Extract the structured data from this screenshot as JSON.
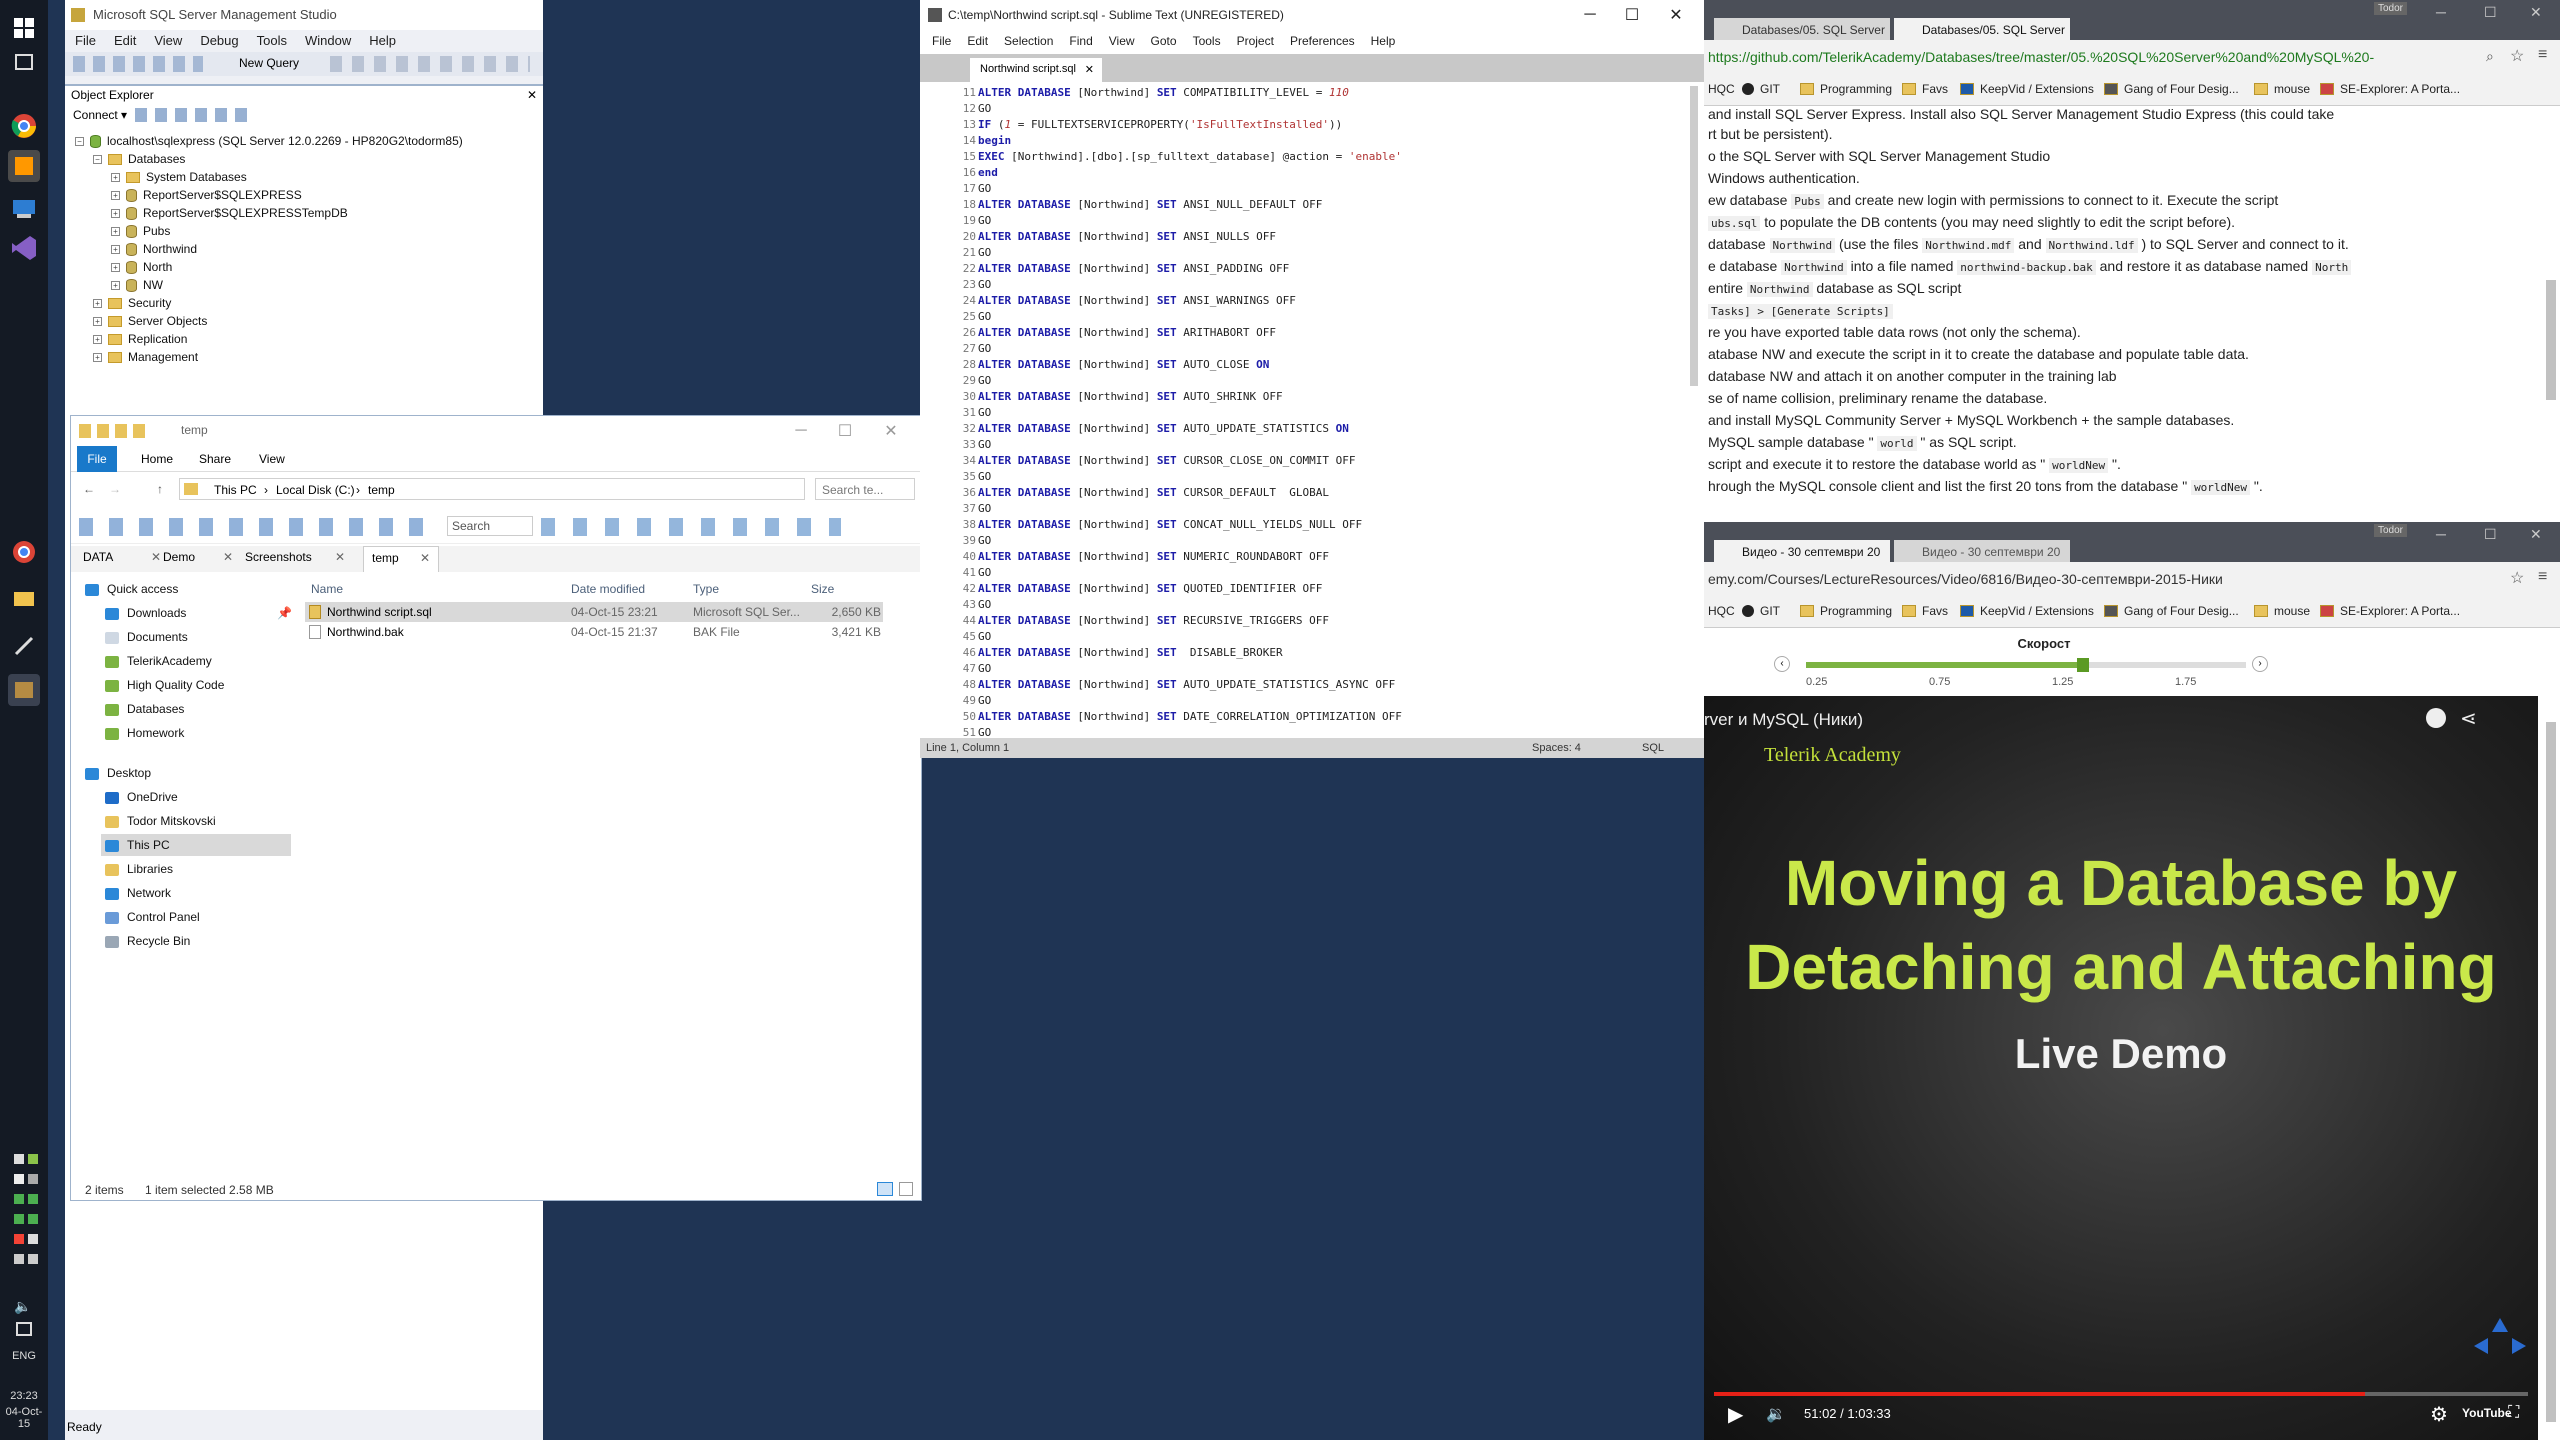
{
  "taskbar": {
    "tray_lang": "ENG",
    "time": "23:23",
    "date": "04-Oct-15"
  },
  "ssms": {
    "title": "Microsoft SQL Server Management Studio",
    "menu": [
      "File",
      "Edit",
      "View",
      "Debug",
      "Tools",
      "Window",
      "Help"
    ],
    "new_query": "New Query",
    "object_explorer_title": "Object Explorer",
    "connect_label": "Connect ▾",
    "server_node": "localhost\\sqlexpress (SQL Server 12.0.2269 - HP820G2\\todorm85)",
    "tree": {
      "databases": "Databases",
      "system_dbs": "System Databases",
      "rs1": "ReportServer$SQLEXPRESS",
      "rs2": "ReportServer$SQLEXPRESSTempDB",
      "pubs": "Pubs",
      "northwind": "Northwind",
      "north": "North",
      "nw": "NW",
      "security": "Security",
      "server_objects": "Server Objects",
      "replication": "Replication",
      "management": "Management"
    },
    "status": "Ready"
  },
  "explorer": {
    "title": "temp",
    "ribbon_tabs": [
      "File",
      "Home",
      "Share",
      "View"
    ],
    "breadcrumb": [
      "This PC",
      "Local Disk (C:)",
      "temp"
    ],
    "search_placeholder": "Search te...",
    "toolbar_search_placeholder": "Search",
    "tabs": [
      "DATA",
      "Demo",
      "Screenshots",
      "temp"
    ],
    "columns": [
      "Name",
      "Date modified",
      "Type",
      "Size"
    ],
    "files": [
      {
        "name": "Northwind script.sql",
        "date": "04-Oct-15 23:21",
        "type": "Microsoft SQL Ser...",
        "size": "2,650 KB"
      },
      {
        "name": "Northwind.bak",
        "date": "04-Oct-15 21:37",
        "type": "BAK File",
        "size": "3,421 KB"
      }
    ],
    "nav": {
      "quick_access": "Quick access",
      "downloads": "Downloads",
      "documents": "Documents",
      "telerik": "TelerikAcademy",
      "hqc": "High Quality Code",
      "databases": "Databases",
      "homework": "Homework",
      "desktop": "Desktop",
      "onedrive": "OneDrive",
      "user": "Todor Mitskovski",
      "thispc": "This PC",
      "libraries": "Libraries",
      "network": "Network",
      "control_panel": "Control Panel",
      "recycle": "Recycle Bin"
    },
    "status_items": "2 items",
    "status_selected": "1 item selected  2.58 MB"
  },
  "sublime": {
    "title": "C:\\temp\\Northwind script.sql - Sublime Text (UNREGISTERED)",
    "menu": [
      "File",
      "Edit",
      "Selection",
      "Find",
      "View",
      "Goto",
      "Tools",
      "Project",
      "Preferences",
      "Help"
    ],
    "tab": "Northwind script.sql",
    "status_left": "Line 1, Column 1",
    "status_spaces": "Spaces: 4",
    "status_syntax": "SQL",
    "lines": [
      {
        "n": "11",
        "t": "ALTER DATABASE [Northwind] SET COMPATIBILITY_LEVEL = 110"
      },
      {
        "n": "12",
        "t": "GO"
      },
      {
        "n": "13",
        "t": "IF (1 = FULLTEXTSERVICEPROPERTY('IsFullTextInstalled'))"
      },
      {
        "n": "14",
        "t": "begin"
      },
      {
        "n": "15",
        "t": "EXEC [Northwind].[dbo].[sp_fulltext_database] @action = 'enable'"
      },
      {
        "n": "16",
        "t": "end"
      },
      {
        "n": "17",
        "t": "GO"
      },
      {
        "n": "18",
        "t": "ALTER DATABASE [Northwind] SET ANSI_NULL_DEFAULT OFF"
      },
      {
        "n": "19",
        "t": "GO"
      },
      {
        "n": "20",
        "t": "ALTER DATABASE [Northwind] SET ANSI_NULLS OFF"
      },
      {
        "n": "21",
        "t": "GO"
      },
      {
        "n": "22",
        "t": "ALTER DATABASE [Northwind] SET ANSI_PADDING OFF"
      },
      {
        "n": "23",
        "t": "GO"
      },
      {
        "n": "24",
        "t": "ALTER DATABASE [Northwind] SET ANSI_WARNINGS OFF"
      },
      {
        "n": "25",
        "t": "GO"
      },
      {
        "n": "26",
        "t": "ALTER DATABASE [Northwind] SET ARITHABORT OFF"
      },
      {
        "n": "27",
        "t": "GO"
      },
      {
        "n": "28",
        "t": "ALTER DATABASE [Northwind] SET AUTO_CLOSE ON"
      },
      {
        "n": "29",
        "t": "GO"
      },
      {
        "n": "30",
        "t": "ALTER DATABASE [Northwind] SET AUTO_SHRINK OFF"
      },
      {
        "n": "31",
        "t": "GO"
      },
      {
        "n": "32",
        "t": "ALTER DATABASE [Northwind] SET AUTO_UPDATE_STATISTICS ON"
      },
      {
        "n": "33",
        "t": "GO"
      },
      {
        "n": "34",
        "t": "ALTER DATABASE [Northwind] SET CURSOR_CLOSE_ON_COMMIT OFF"
      },
      {
        "n": "35",
        "t": "GO"
      },
      {
        "n": "36",
        "t": "ALTER DATABASE [Northwind] SET CURSOR_DEFAULT  GLOBAL"
      },
      {
        "n": "37",
        "t": "GO"
      },
      {
        "n": "38",
        "t": "ALTER DATABASE [Northwind] SET CONCAT_NULL_YIELDS_NULL OFF"
      },
      {
        "n": "39",
        "t": "GO"
      },
      {
        "n": "40",
        "t": "ALTER DATABASE [Northwind] SET NUMERIC_ROUNDABORT OFF"
      },
      {
        "n": "41",
        "t": "GO"
      },
      {
        "n": "42",
        "t": "ALTER DATABASE [Northwind] SET QUOTED_IDENTIFIER OFF"
      },
      {
        "n": "43",
        "t": "GO"
      },
      {
        "n": "44",
        "t": "ALTER DATABASE [Northwind] SET RECURSIVE_TRIGGERS OFF"
      },
      {
        "n": "45",
        "t": "GO"
      },
      {
        "n": "46",
        "t": "ALTER DATABASE [Northwind] SET  DISABLE_BROKER"
      },
      {
        "n": "47",
        "t": "GO"
      },
      {
        "n": "48",
        "t": "ALTER DATABASE [Northwind] SET AUTO_UPDATE_STATISTICS_ASYNC OFF"
      },
      {
        "n": "49",
        "t": "GO"
      },
      {
        "n": "50",
        "t": "ALTER DATABASE [Northwind] SET DATE_CORRELATION_OPTIMIZATION OFF"
      },
      {
        "n": "51",
        "t": "GO"
      }
    ]
  },
  "chrome1": {
    "tab1": "Databases/05. SQL Server",
    "tab2": "Databases/05. SQL Server",
    "url": "https://github.com/TelerikAcademy/Databases/tree/master/05.%20SQL%20Server%20and%20MySQL%20-",
    "bookmarks": [
      "HQC",
      "GIT",
      "Programming",
      "Favs",
      "KeepVid / Extensions",
      "Gang of Four Desig...",
      "mouse",
      "SE-Explorer: A Porta..."
    ],
    "user": "Todor",
    "lines": [
      "and install SQL Server Express. Install also SQL Server Management Studio Express (this could take",
      "rt but be persistent).",
      "o the SQL Server with SQL Server Management Studio",
      "Windows authentication.",
      "ew database ",
      "Pubs",
      " and create new login with permissions to connect to it. Execute the script",
      "ubs.sql",
      " to populate the DB contents (you may need slightly to edit the script before).",
      "database ",
      "Northwind",
      " (use the files ",
      "Northwind.mdf",
      " and ",
      "Northwind.ldf",
      " ) to SQL Server and connect to it.",
      "e database ",
      "Northwind",
      " into a file named ",
      "northwind-backup.bak",
      " and restore it as database named ",
      "North",
      "entire ",
      "Northwind",
      " database as SQL script",
      "Tasks] > [Generate Scripts]",
      "re you have exported table data rows (not only the schema).",
      "atabase NW and execute the script in it to create the database and populate table data.",
      " database NW and attach it on another computer in the training lab",
      "se of name collision, preliminary rename the database.",
      "and install MySQL Community Server + MySQL Workbench + the sample databases.",
      " MySQL sample database \" ",
      "world",
      " \" as SQL script.",
      " script and execute it to restore the database world as \" ",
      "worldNew",
      " \".",
      "hrough the MySQL console client and list the first 20 tons from the database \" ",
      "worldNew",
      " \"."
    ]
  },
  "chrome2": {
    "tab1": "Видео - 30 септември 20",
    "tab2": "Видео - 30 септември 20",
    "url": "emy.com/Courses/LectureResources/Video/6816/Видео-30-септември-2015-Ники",
    "user": "Todor",
    "speed_label": "Скорост",
    "speed_ticks": [
      "0.25",
      "0.75",
      "1.25",
      "1.75"
    ],
    "speed_value": 0.63,
    "video_header": "rver и MySQL (Ники)",
    "brand": "Telerik Academy",
    "slide_line1": "Moving a Database by",
    "slide_line2": "Detaching and Attaching",
    "slide_sub": "Live Demo",
    "time": "51:02 / 1:03:33",
    "progress": 0.8,
    "yt": "YouTube"
  }
}
